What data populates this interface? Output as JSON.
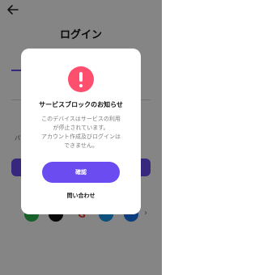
{
  "page": {
    "title": "ログイン",
    "back_icon": "arrow-left-icon"
  },
  "background": {
    "partial_label": "パ"
  },
  "social": {
    "items": [
      {
        "name": "line-icon"
      },
      {
        "name": "tiktok-icon"
      },
      {
        "name": "google-icon",
        "glyph": "G"
      },
      {
        "name": "twitter-icon"
      },
      {
        "name": "facebook-icon"
      }
    ],
    "more_glyph": "›"
  },
  "modal": {
    "icon": "exclamation-icon",
    "title": "サービスブロックのお知らせ",
    "message_lines": [
      "このデバイスはサービスの利用",
      "が停止されています。",
      "アカウント作成及びログインは",
      "できません。"
    ],
    "confirm_label": "確認",
    "contact_label": "問い合わせ"
  },
  "colors": {
    "accent": "#6a4cf0",
    "alert": "#ff4f6e",
    "overlay": "rgba(0,0,0,0.48)"
  }
}
